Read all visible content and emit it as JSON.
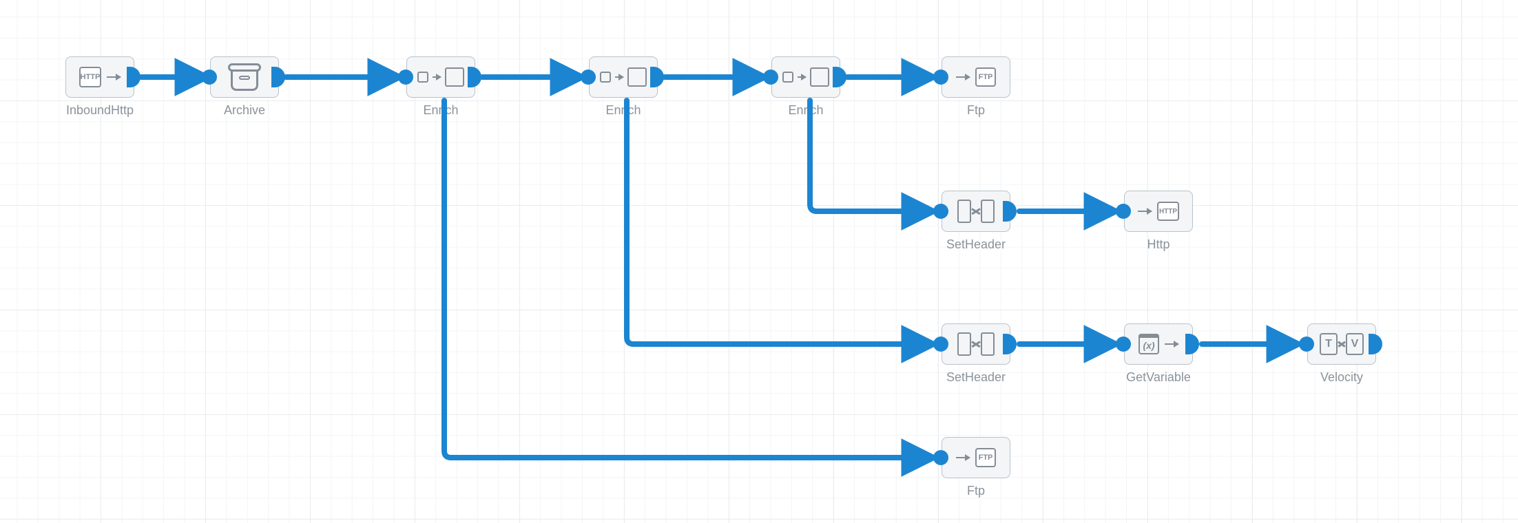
{
  "accent": "#1c85d1",
  "nodes": {
    "inboundHttp": {
      "label": "InboundHttp",
      "badge": "HTTP"
    },
    "archive": {
      "label": "Archive"
    },
    "enrich1": {
      "label": "Enrich"
    },
    "enrich2": {
      "label": "Enrich"
    },
    "enrich3": {
      "label": "Enrich"
    },
    "ftp1": {
      "label": "Ftp",
      "badge": "FTP"
    },
    "setHeader1": {
      "label": "SetHeader"
    },
    "http": {
      "label": "Http",
      "badge": "HTTP"
    },
    "setHeader2": {
      "label": "SetHeader"
    },
    "getVariable": {
      "label": "GetVariable",
      "badge": "(x)"
    },
    "velocity": {
      "label": "Velocity",
      "leftBadge": "T",
      "rightBadge": "V"
    },
    "ftp2": {
      "label": "Ftp",
      "badge": "FTP"
    }
  }
}
